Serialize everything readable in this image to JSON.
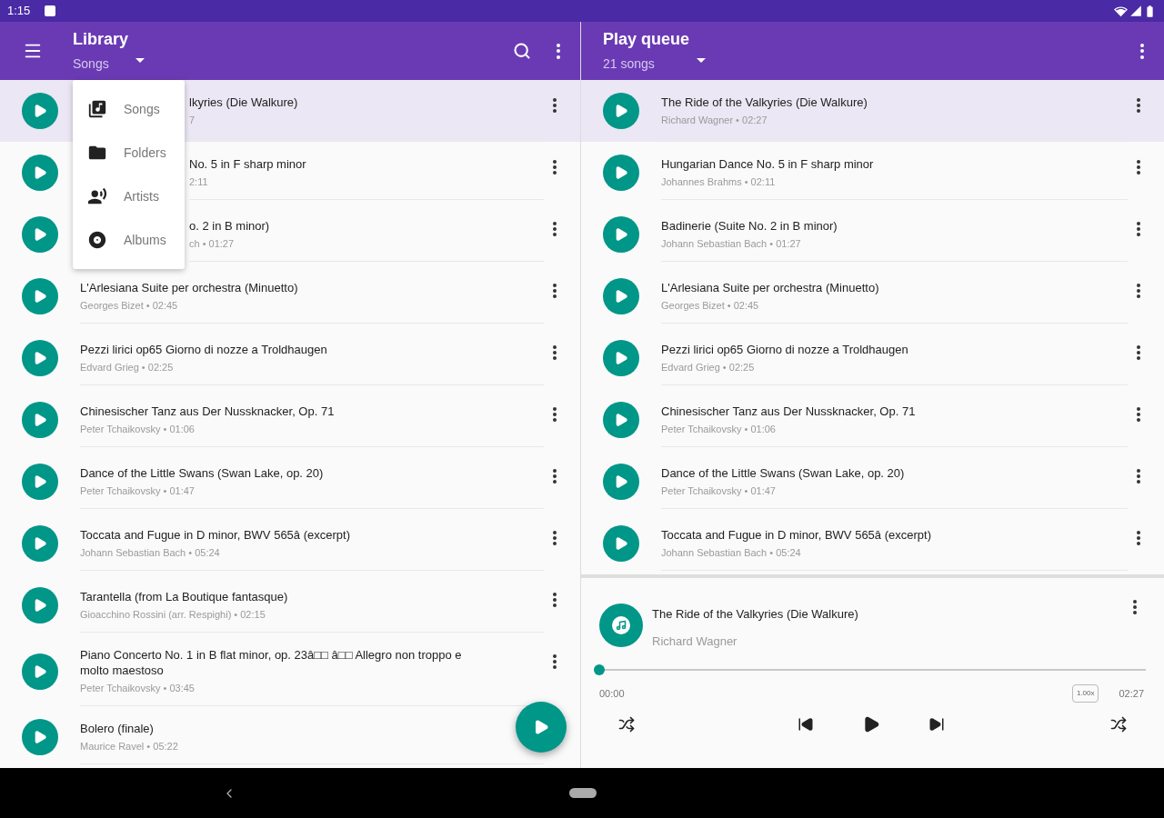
{
  "status_bar": {
    "time": "1:15"
  },
  "library": {
    "title": "Library",
    "subtitle": "Songs",
    "songs": [
      {
        "kind": "covered",
        "title": "lkyries (Die Walkure)",
        "subtitle": "7",
        "selected": true
      },
      {
        "kind": "covered",
        "title": "No. 5 in F sharp minor",
        "subtitle": "2:11",
        "selected": false
      },
      {
        "kind": "covered",
        "title": "o. 2 in B minor)",
        "subtitle": "ch • 01:27",
        "selected": false
      },
      {
        "kind": "full",
        "title": "L'Arlesiana Suite per orchestra (Minuetto)",
        "subtitle": "Georges Bizet • 02:45",
        "selected": false
      },
      {
        "kind": "full",
        "title": "Pezzi lirici op65 Giorno di nozze a Troldhaugen",
        "subtitle": "Edvard Grieg • 02:25",
        "selected": false
      },
      {
        "kind": "full",
        "title": "Chinesischer Tanz aus Der Nussknacker, Op. 71",
        "subtitle": "Peter Tchaikovsky • 01:06",
        "selected": false
      },
      {
        "kind": "full",
        "title": "Dance of the Little Swans (Swan Lake, op. 20)",
        "subtitle": "Peter Tchaikovsky • 01:47",
        "selected": false
      },
      {
        "kind": "full",
        "title": "Toccata and Fugue in D minor, BWV 565â (excerpt)",
        "subtitle": "Johann Sebastian Bach • 05:24",
        "selected": false
      },
      {
        "kind": "full",
        "title": "Tarantella (from La Boutique fantasque)",
        "subtitle": "Gioacchino Rossini (arr. Respighi) • 02:15",
        "selected": false
      },
      {
        "kind": "full",
        "title": "Piano Concerto No. 1 in B flat minor, op. 23â□□ â□□ Allegro non troppo e molto maestoso",
        "subtitle": "Peter Tchaikovsky • 03:45",
        "selected": false
      },
      {
        "kind": "plain",
        "title": "Bolero (finale)",
        "subtitle": "Maurice Ravel • 05:22",
        "selected": false
      }
    ],
    "menu": [
      {
        "kind": "songs",
        "label": "Songs"
      },
      {
        "kind": "folders",
        "label": "Folders"
      },
      {
        "kind": "artists",
        "label": "Artists"
      },
      {
        "kind": "albums",
        "label": "Albums"
      }
    ]
  },
  "queue": {
    "title": "Play queue",
    "subtitle": "21 songs",
    "songs": [
      {
        "title": "The Ride of the Valkyries (Die Walkure)",
        "subtitle": "Richard Wagner • 02:27",
        "selected": true
      },
      {
        "title": "Hungarian Dance No. 5 in F sharp minor",
        "subtitle": "Johannes Brahms • 02:11",
        "selected": false
      },
      {
        "title": "Badinerie (Suite No. 2 in B minor)",
        "subtitle": "Johann Sebastian Bach • 01:27",
        "selected": false
      },
      {
        "title": "L'Arlesiana Suite per orchestra (Minuetto)",
        "subtitle": "Georges Bizet • 02:45",
        "selected": false
      },
      {
        "title": "Pezzi lirici op65 Giorno di nozze a Troldhaugen",
        "subtitle": "Edvard Grieg • 02:25",
        "selected": false
      },
      {
        "title": "Chinesischer Tanz aus Der Nussknacker, Op. 71",
        "subtitle": "Peter Tchaikovsky • 01:06",
        "selected": false
      },
      {
        "title": "Dance of the Little Swans (Swan Lake, op. 20)",
        "subtitle": "Peter Tchaikovsky • 01:47",
        "selected": false
      },
      {
        "title": "Toccata and Fugue in D minor, BWV 565â (excerpt)",
        "subtitle": "Johann Sebastian Bach • 05:24",
        "selected": false
      }
    ]
  },
  "now_playing": {
    "title": "The Ride of the Valkyries (Die Walkure)",
    "artist": "Richard Wagner",
    "level": 0,
    "elapsed": "00:00",
    "speed": "1.00x",
    "duration": "02:27"
  }
}
